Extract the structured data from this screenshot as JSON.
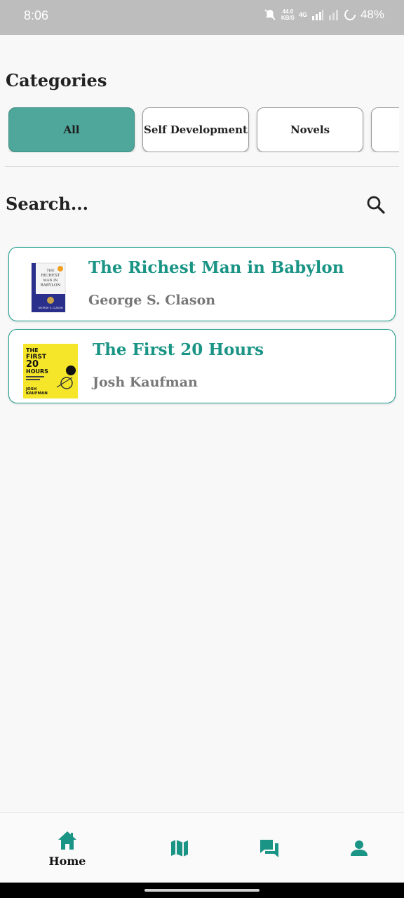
{
  "status_bar": {
    "time": "8:06",
    "net_speed_value": "44.0",
    "net_speed_unit": "KB/S",
    "network_type": "4G",
    "battery_percent": "48%"
  },
  "categories": {
    "title": "Categories",
    "chips": [
      {
        "label": "All",
        "selected": true
      },
      {
        "label": "Self Development",
        "selected": false
      },
      {
        "label": "Novels",
        "selected": false
      },
      {
        "label": "",
        "selected": false
      }
    ]
  },
  "search": {
    "label": "Search..."
  },
  "books": [
    {
      "title": "The Richest Man in Babylon",
      "author": "George S. Clason",
      "cover_icon": "book-cover-richest-man"
    },
    {
      "title": "The First 20 Hours",
      "author": "Josh Kaufman",
      "cover_icon": "book-cover-first-20-hours"
    }
  ],
  "covers": {
    "richest": {
      "line1": "THE",
      "line2": "RICHEST",
      "line3": "MAN IN",
      "line4": "BABYLON",
      "author": "GEORGE S. CLASON"
    },
    "first20": {
      "line1": "THE",
      "line2": "FIRST",
      "line3": "20",
      "line4": "HOURS",
      "author": "JOSH",
      "author2": "KAUFMAN"
    }
  },
  "bottom_nav": {
    "items": [
      {
        "label": "Home",
        "icon": "home-icon",
        "active": true
      },
      {
        "label": "",
        "icon": "map-icon",
        "active": false
      },
      {
        "label": "",
        "icon": "chat-icon",
        "active": false
      },
      {
        "label": "",
        "icon": "person-icon",
        "active": false
      }
    ]
  },
  "colors": {
    "accent": "#1a9485",
    "chip_selected": "#4ea79a",
    "status_bar": "#bdbdbd"
  }
}
